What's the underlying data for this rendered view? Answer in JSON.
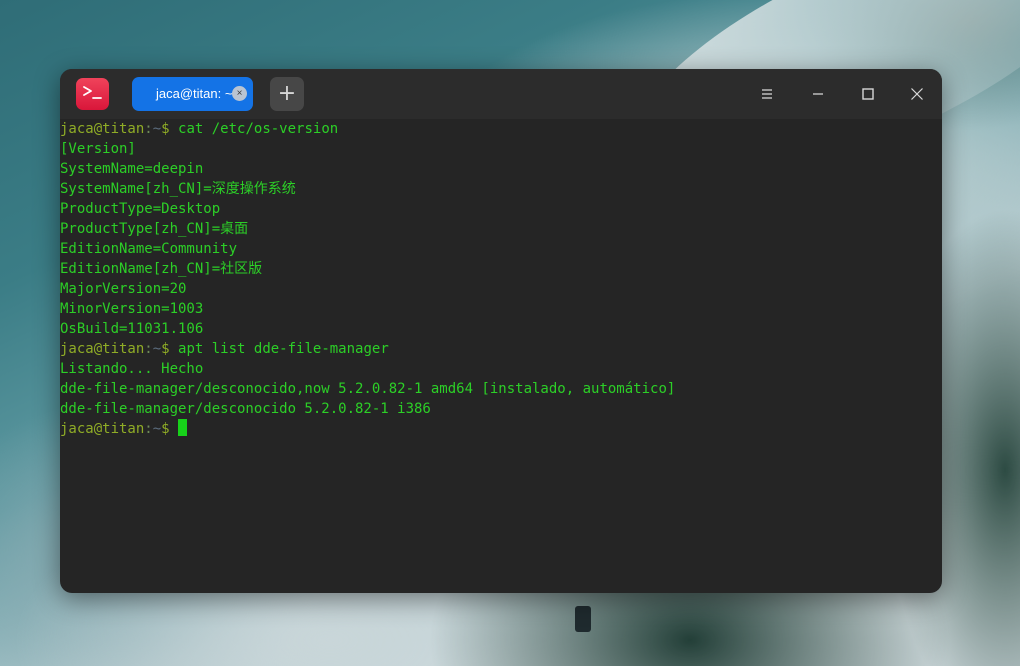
{
  "window": {
    "tab_title": "jaca@titan: ~",
    "tab_close_glyph": "×",
    "new_tab_glyph": "+",
    "icons": [
      "terminal-app-icon",
      "menu-icon",
      "minimize-icon",
      "maximize-icon",
      "close-icon"
    ]
  },
  "colors": {
    "output_green": "#2ccf27",
    "prompt_user": "#8fac26",
    "tab_active": "#1473e6",
    "cursor": "#17d11a",
    "background": "#252525"
  },
  "prompt": {
    "user": "jaca@titan",
    "sep": ":",
    "path": "~",
    "dollar": "$"
  },
  "terminal": {
    "cmd1": " cat /etc/os-version",
    "out1": [
      "[Version]",
      "SystemName=deepin",
      "SystemName[zh_CN]=深度操作系统",
      "ProductType=Desktop",
      "ProductType[zh_CN]=桌面",
      "EditionName=Community",
      "EditionName[zh_CN]=社区版",
      "MajorVersion=20",
      "MinorVersion=1003",
      "OsBuild=11031.106"
    ],
    "cmd2": " apt list dde-file-manager",
    "out2": [
      "Listando... Hecho",
      "dde-file-manager/desconocido,now 5.2.0.82-1 amd64 [instalado, automático]",
      "dde-file-manager/desconocido 5.2.0.82-1 i386"
    ],
    "cmd3": " "
  }
}
